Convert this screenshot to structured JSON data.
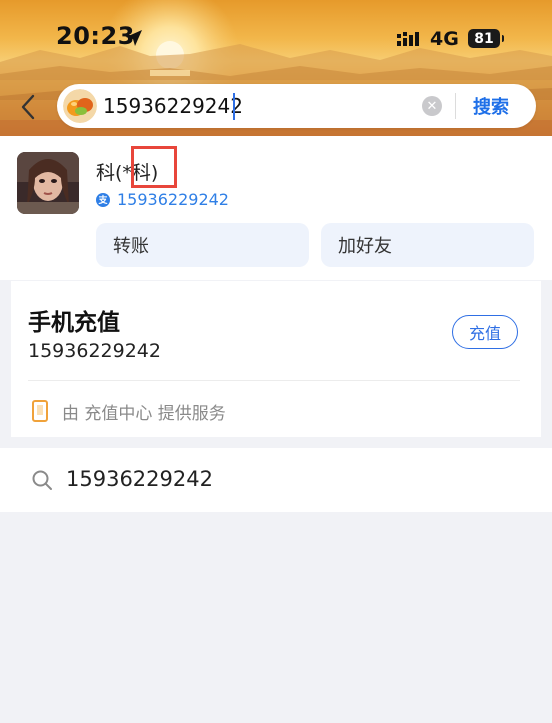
{
  "status_bar": {
    "time": "20:23",
    "network": "4G",
    "battery": "81"
  },
  "search": {
    "query": "15936229242",
    "button_label": "搜索"
  },
  "contact": {
    "name": "科(*科)",
    "phone": "15936229242",
    "actions": {
      "transfer": "转账",
      "add_friend": "加好友"
    }
  },
  "recharge": {
    "title": "手机充值",
    "phone": "15936229242",
    "button_label": "充值",
    "provider_text": "由 充值中心 提供服务"
  },
  "suggestion": {
    "text": "15936229242"
  },
  "colors": {
    "accent": "#2f6fe4",
    "highlight": "#e8463b",
    "page_bg": "#f1f2f6"
  }
}
